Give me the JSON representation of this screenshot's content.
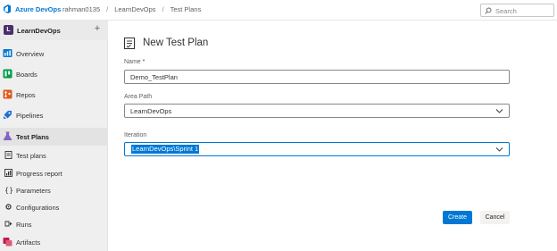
{
  "header": {
    "brand": "Azure DevOps",
    "breadcrumbs": [
      "rahman0135",
      "LearnDevOps",
      "Test Plans"
    ],
    "separator": "/",
    "search_placeholder": "Search"
  },
  "sidebar": {
    "project_initial": "L",
    "project_name": "LearnDevOps",
    "add_symbol": "+",
    "items": [
      {
        "label": "Overview",
        "icon": "overview-icon"
      },
      {
        "label": "Boards",
        "icon": "boards-icon"
      },
      {
        "label": "Repos",
        "icon": "repos-icon"
      },
      {
        "label": "Pipelines",
        "icon": "pipelines-icon"
      },
      {
        "label": "Test Plans",
        "icon": "test-plans-icon"
      },
      {
        "label": "Test plans",
        "icon": "test-plans-sub-icon"
      },
      {
        "label": "Progress report",
        "icon": "progress-report-icon"
      },
      {
        "label": "Parameters",
        "icon": "parameters-icon"
      },
      {
        "label": "Configurations",
        "icon": "configurations-icon"
      },
      {
        "label": "Runs",
        "icon": "runs-icon"
      },
      {
        "label": "Artifacts",
        "icon": "artifacts-icon"
      }
    ]
  },
  "dialog": {
    "title": "New Test Plan",
    "name_label": "Name",
    "required_mark": "*",
    "name_value": "Demo_TestPlan",
    "area_label": "Area Path",
    "area_value": "LearnDevOps",
    "iteration_label": "Iteration",
    "iteration_value": "LearnDevOps\\Sprint 1",
    "create_label": "Create",
    "cancel_label": "Cancel"
  },
  "colors": {
    "accent": "#0078d4",
    "test_plans": "#8661c5",
    "sidebar_bg": "#efefef"
  }
}
